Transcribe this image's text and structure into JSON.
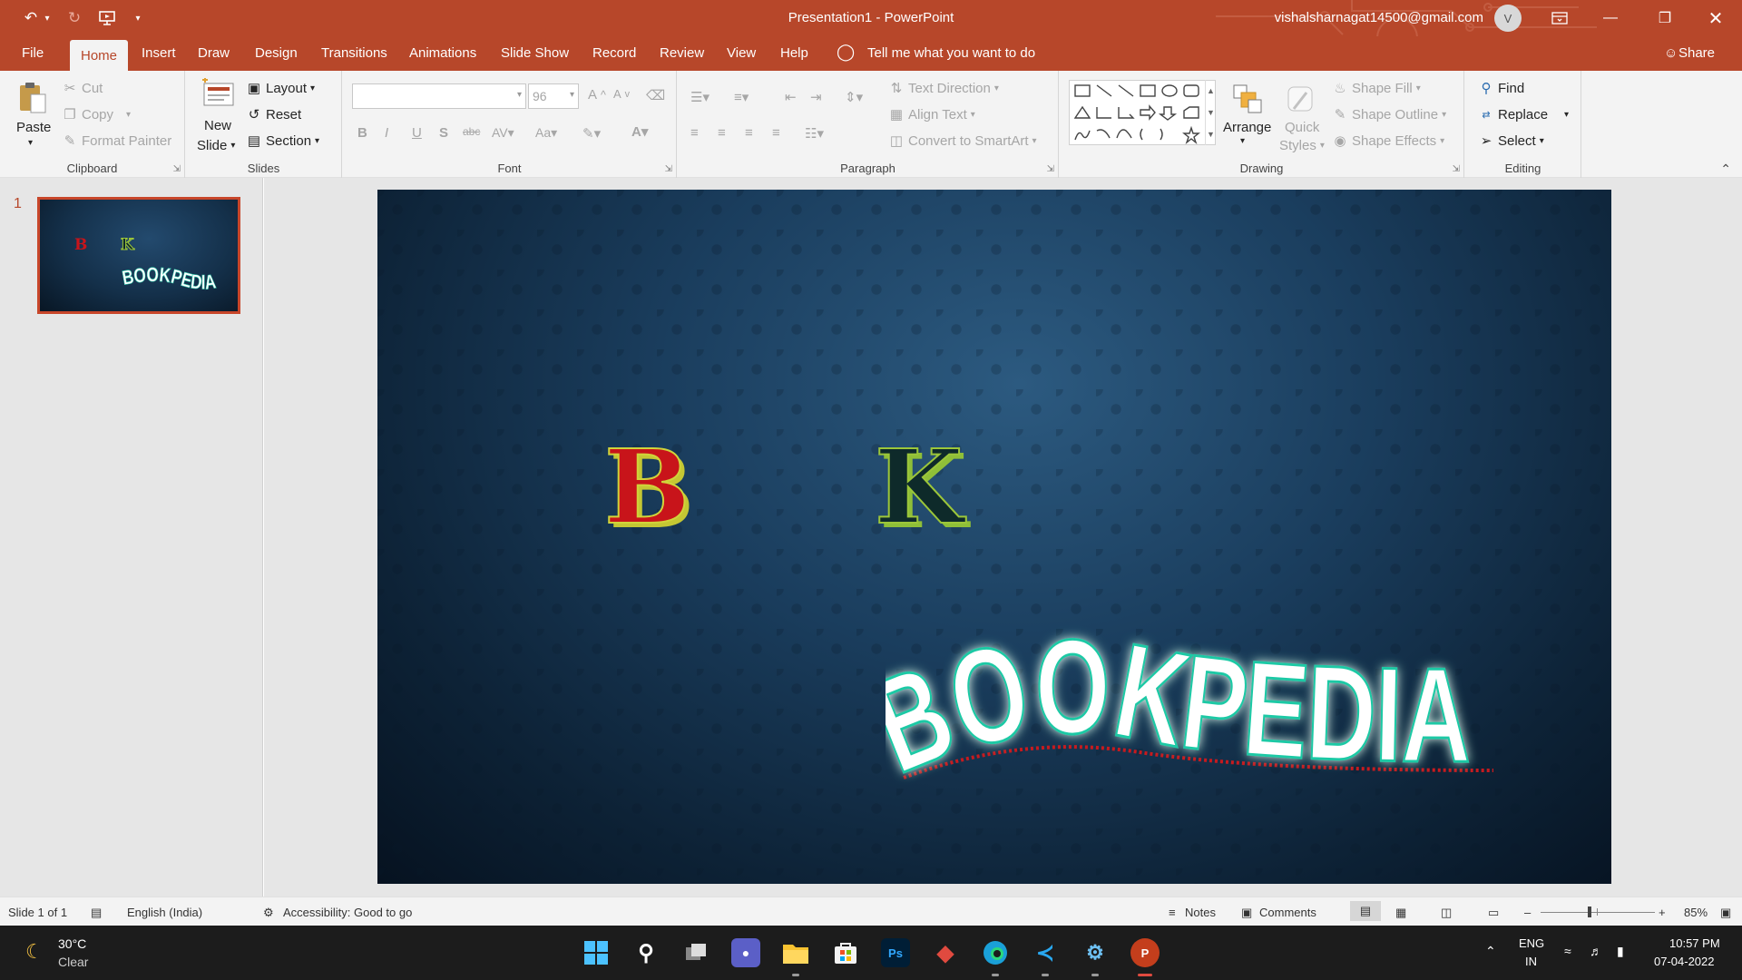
{
  "title_bar": {
    "title": "Presentation1  -  PowerPoint",
    "account_email": "vishalsharnagat14500@gmail.com",
    "avatar_initial": "V"
  },
  "menu": {
    "items": [
      "File",
      "Insert",
      "Draw",
      "Design",
      "Transitions",
      "Animations",
      "Slide Show",
      "Record",
      "Review",
      "View",
      "Help"
    ],
    "active": "Home",
    "tell_me": "Tell me what you want to do",
    "share": "Share"
  },
  "ribbon": {
    "clipboard": {
      "label": "Clipboard",
      "paste": "Paste",
      "cut": "Cut",
      "copy": "Copy",
      "format_painter": "Format Painter"
    },
    "slides": {
      "label": "Slides",
      "new_slide": "New",
      "new_slide_2": "Slide",
      "layout": "Layout",
      "reset": "Reset",
      "section": "Section"
    },
    "font": {
      "label": "Font",
      "font_name": "",
      "font_size": "96"
    },
    "paragraph": {
      "label": "Paragraph",
      "text_direction": "Text Direction",
      "align_text": "Align Text",
      "convert_smartart": "Convert to SmartArt"
    },
    "drawing": {
      "label": "Drawing",
      "arrange": "Arrange",
      "quick_styles": "Quick",
      "quick_styles_2": "Styles",
      "shape_fill": "Shape Fill",
      "shape_outline": "Shape Outline",
      "shape_effects": "Shape Effects"
    },
    "editing": {
      "label": "Editing",
      "find": "Find",
      "replace": "Replace",
      "select": "Select"
    }
  },
  "slide_panel": {
    "slide_number": "1"
  },
  "slide": {
    "letter_b": "B",
    "letter_k": "K",
    "wordart": "BOOKPEDIA",
    "thumb_wordart": "BOOKPEDIA"
  },
  "status_bar": {
    "slide_info": "Slide 1 of 1",
    "language": "English (India)",
    "accessibility": "Accessibility: Good to go",
    "notes": "Notes",
    "comments": "Comments",
    "zoom": "85%",
    "zoom_level": 0.85
  },
  "taskbar": {
    "weather_temp": "30°C",
    "weather_desc": "Clear",
    "lang_1": "ENG",
    "lang_2": "IN",
    "time": "10:57 PM",
    "date": "07-04-2022"
  },
  "colors": {
    "accent": "#b7472a",
    "slide_bg": "#1a3d5d"
  }
}
